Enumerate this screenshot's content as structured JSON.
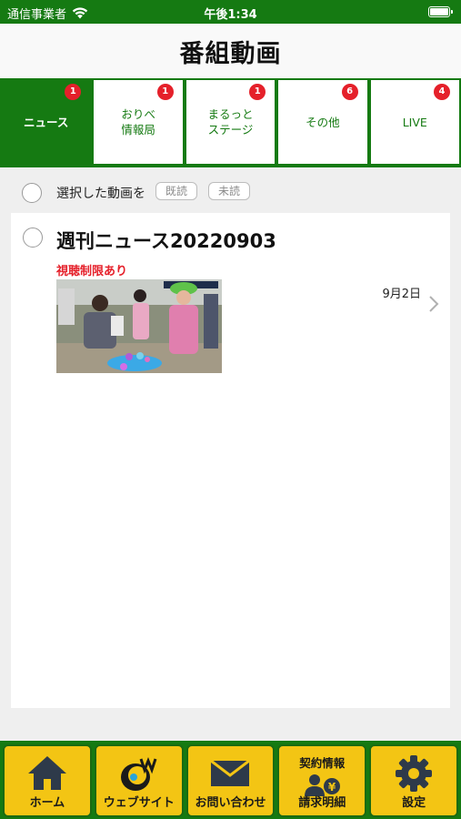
{
  "status_bar": {
    "carrier": "通信事業者",
    "time": "午後1:34"
  },
  "nav": {
    "title": "番組動画"
  },
  "tabs": [
    {
      "label": "ニュース",
      "badge": "1",
      "active": true
    },
    {
      "label_line1": "おりべ",
      "label_line2": "情報局",
      "badge": "1"
    },
    {
      "label_line1": "まるっと",
      "label_line2": "ステージ",
      "badge": "1"
    },
    {
      "label": "その他",
      "badge": "6"
    },
    {
      "label": "LIVE",
      "badge": "4"
    }
  ],
  "action_row": {
    "select_label": "選択した動画を",
    "read_button": "既読",
    "unread_button": "未読"
  },
  "videos": [
    {
      "title": "週刊ニュース20220903",
      "restriction": "視聴制限あり",
      "date": "9月2日"
    }
  ],
  "bottom_tabs": {
    "home": "ホーム",
    "website": "ウェブサイト",
    "contact": "お問い合わせ",
    "contract_line1": "契約情報",
    "contract_line2": "請求明細",
    "settings": "設定"
  },
  "colors": {
    "brand_green": "#157a12",
    "badge_red": "#e5202a",
    "tab_yellow": "#f3c514"
  }
}
